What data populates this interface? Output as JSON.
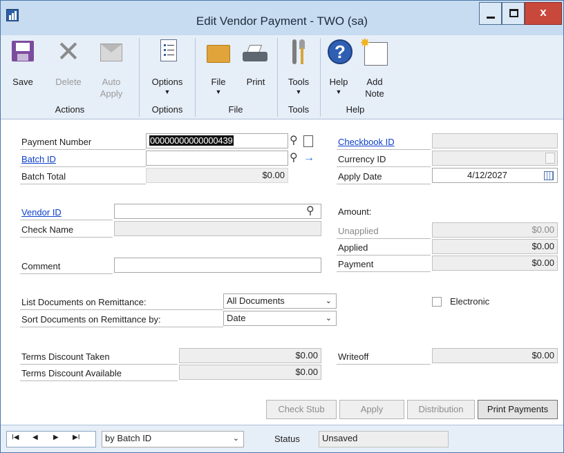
{
  "window": {
    "title": "Edit Vendor Payment  -  TWO (sa)",
    "minimize_glyph": "—",
    "restore_glyph": "□",
    "close_glyph": "x"
  },
  "ribbon": {
    "save": "Save",
    "delete": "Delete",
    "auto_apply_1": "Auto",
    "auto_apply_2": "Apply",
    "options": "Options",
    "file": "File",
    "print": "Print",
    "tools": "Tools",
    "help": "Help",
    "add_note_1": "Add",
    "add_note_2": "Note",
    "caret": "▼",
    "groups": {
      "actions": "Actions",
      "options": "Options",
      "file": "File",
      "tools": "Tools",
      "help": "Help"
    }
  },
  "form": {
    "payment_number_label": "Payment Number",
    "payment_number_value": "00000000000000439",
    "batch_id_label": "Batch ID",
    "batch_id_value": "",
    "batch_total_label": "Batch Total",
    "batch_total_value": "$0.00",
    "checkbook_id_label": "Checkbook ID",
    "checkbook_id_value": "",
    "currency_id_label": "Currency ID",
    "currency_id_value": "",
    "apply_date_label": "Apply Date",
    "apply_date_value": "4/12/2027",
    "vendor_id_label": "Vendor ID",
    "vendor_id_value": "",
    "check_name_label": "Check Name",
    "check_name_value": "",
    "comment_label": "Comment",
    "comment_value": "",
    "amount_label": "Amount:",
    "unapplied_label": "Unapplied",
    "unapplied_value": "$0.00",
    "applied_label": "Applied",
    "applied_value": "$0.00",
    "payment_label": "Payment",
    "payment_value": "$0.00",
    "list_docs_label": "List Documents on Remittance:",
    "list_docs_value": "All Documents",
    "sort_docs_label": "Sort Documents on Remittance by:",
    "sort_docs_value": "Date",
    "electronic_label": "Electronic",
    "electronic_checked": false,
    "terms_taken_label": "Terms Discount Taken",
    "terms_taken_value": "$0.00",
    "terms_available_label": "Terms Discount Available",
    "terms_available_value": "$0.00",
    "writeoff_label": "Writeoff",
    "writeoff_value": "$0.00"
  },
  "buttons": {
    "check_stub": "Check Stub",
    "apply": "Apply",
    "distribution": "Distribution",
    "print_payments": "Print Payments"
  },
  "statusbar": {
    "nav_first": "I◀",
    "nav_prev": "◀",
    "nav_next": "▶",
    "nav_last": "▶I",
    "sort_value": "by Batch ID",
    "status_label": "Status",
    "status_value": "Unsaved"
  },
  "colors": {
    "title_bar": "#c7dcf1",
    "ribbon": "#e6eef8",
    "link": "#0b3ec9",
    "close_button": "#c9483c"
  }
}
